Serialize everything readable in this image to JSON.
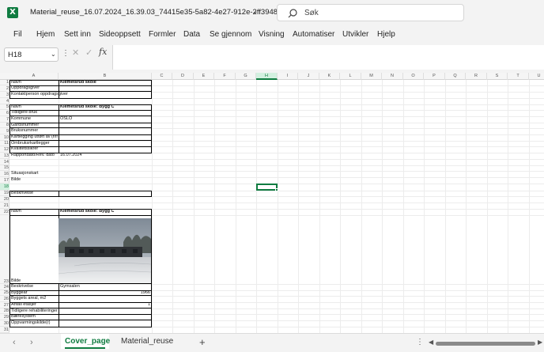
{
  "window": {
    "title": "Material_reuse_16.07.2024_16.39.03_74415e35-5a82-4e27-912e-2ff394895...",
    "app_icon": "excel-logo",
    "app_letter": "X",
    "brand_color": "#107c41"
  },
  "search": {
    "placeholder": "Søk"
  },
  "menu": [
    "Fil",
    "Hjem",
    "Sett inn",
    "Sideoppsett",
    "Formler",
    "Data",
    "Se gjennom",
    "Visning",
    "Automatiser",
    "Utvikler",
    "Hjelp"
  ],
  "formula_bar": {
    "cell_ref": "H18",
    "fx": "fx",
    "value": ""
  },
  "columns": [
    "A",
    "B",
    "C",
    "D",
    "E",
    "F",
    "G",
    "H",
    "I",
    "J",
    "K",
    "L",
    "M",
    "N",
    "O",
    "P",
    "Q",
    "R",
    "S",
    "T",
    "U"
  ],
  "rows": [
    "1",
    "2",
    "3",
    "4",
    "5",
    "6",
    "7",
    "8",
    "9",
    "10",
    "11",
    "12",
    "13",
    "14",
    "15",
    "16",
    "17",
    "18",
    "19",
    "20",
    "21",
    "22",
    "23",
    "24",
    "25",
    "26",
    "27",
    "28",
    "29",
    "30",
    "31"
  ],
  "selected": {
    "column": "H",
    "row": "18"
  },
  "cells": {
    "a1": "Navn",
    "b1": "Klemetsrud skole",
    "a2": "Oppdragsgiver",
    "a3": "Kontaktperson oppdragsgiver",
    "a5": "Navn",
    "b5": "Klemetsrud skole: Bygg C",
    "a6": "Tidligere bruk",
    "a7": "Kommune",
    "b7": "OSLO",
    "a8": "Gårdsnummer",
    "a9": "Bruksnummer",
    "a10": "Kartlegging utført av (firma)",
    "a11": "Ombruksrkartlegger",
    "a12": "Kvalitetssikrer",
    "a13": "Rapportdato/Rev. dato",
    "b13": "16.07.2024",
    "a16": "Situasjonskart",
    "a17": "Bilde",
    "a19": "Beskrivelse",
    "a22": "Navn",
    "b22": "Klemetsrud skole: Bygg C",
    "a23": "Bilde",
    "a24": "Beskrivelse",
    "b24": "Gymsalen",
    "a25": "Byggeår",
    "b25": "1966",
    "a26": "Byggets areal, m2",
    "a27": "Antall etasjer",
    "b27": "1",
    "a28": "Tidligere rehabiliteringer, år",
    "a29": "Bæresystem",
    "a30": "Oppvarmingskilde(r)"
  },
  "sheet_tabs": [
    "Cover_page",
    "Material_reuse"
  ],
  "active_tab": "Cover_page"
}
